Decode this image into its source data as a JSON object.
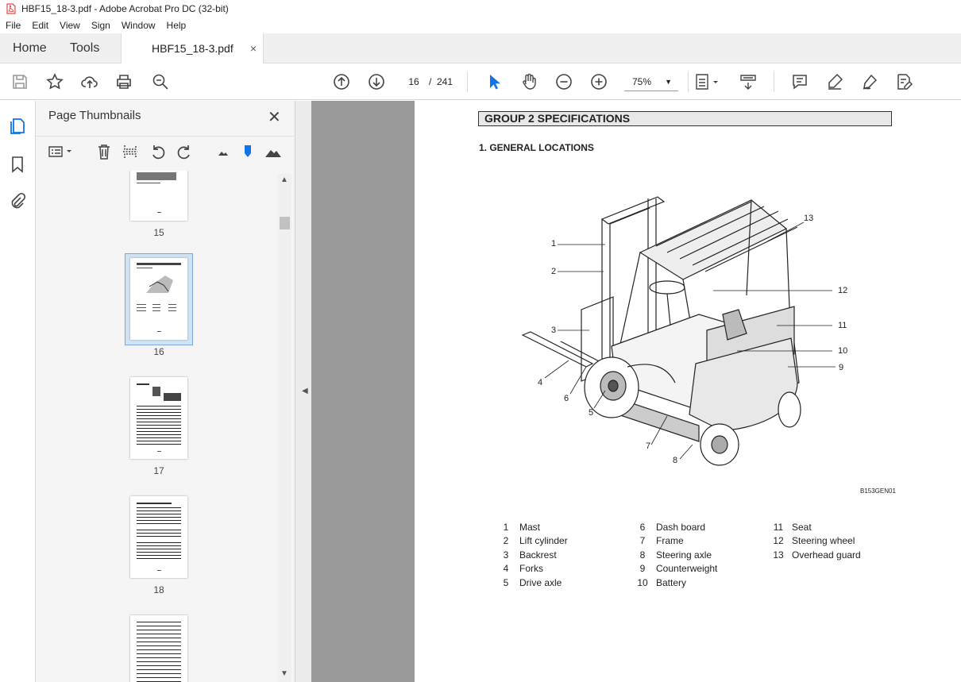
{
  "window": {
    "title": "HBF15_18-3.pdf - Adobe Acrobat Pro DC (32-bit)"
  },
  "menu": [
    "File",
    "Edit",
    "View",
    "Sign",
    "Window",
    "Help"
  ],
  "tabs": {
    "home": "Home",
    "tools": "Tools",
    "doc": "HBF15_18-3.pdf",
    "close": "×"
  },
  "toolbar": {
    "page_current": "16",
    "page_sep": "/",
    "page_total": "241",
    "zoom": "75%"
  },
  "panel": {
    "title": "Page Thumbnails",
    "close": "✕",
    "thumb_labels": [
      "15",
      "16",
      "17",
      "18"
    ]
  },
  "document": {
    "group_header": "GROUP 2  SPECIFICATIONS",
    "section_heading": "1. GENERAL LOCATIONS",
    "figure_id": "B153GEN01",
    "callouts": [
      "1",
      "2",
      "3",
      "4",
      "5",
      "6",
      "7",
      "8",
      "9",
      "10",
      "11",
      "12",
      "13"
    ],
    "legend_col1": [
      {
        "n": "1",
        "label": "Mast"
      },
      {
        "n": "2",
        "label": "Lift cylinder"
      },
      {
        "n": "3",
        "label": "Backrest"
      },
      {
        "n": "4",
        "label": "Forks"
      },
      {
        "n": "5",
        "label": "Drive axle"
      }
    ],
    "legend_col2": [
      {
        "n": "6",
        "label": "Dash board"
      },
      {
        "n": "7",
        "label": "Frame"
      },
      {
        "n": "8",
        "label": "Steering axle"
      },
      {
        "n": "9",
        "label": "Counterweight"
      },
      {
        "n": "10",
        "label": "Battery"
      }
    ],
    "legend_col3": [
      {
        "n": "11",
        "label": "Seat"
      },
      {
        "n": "12",
        "label": "Steering wheel"
      },
      {
        "n": "13",
        "label": "Overhead guard"
      }
    ]
  },
  "colors": {
    "accent_blue": "#1473e6",
    "panel_bg": "#f5f5f5",
    "viewer_gray": "#9a9a9a"
  }
}
